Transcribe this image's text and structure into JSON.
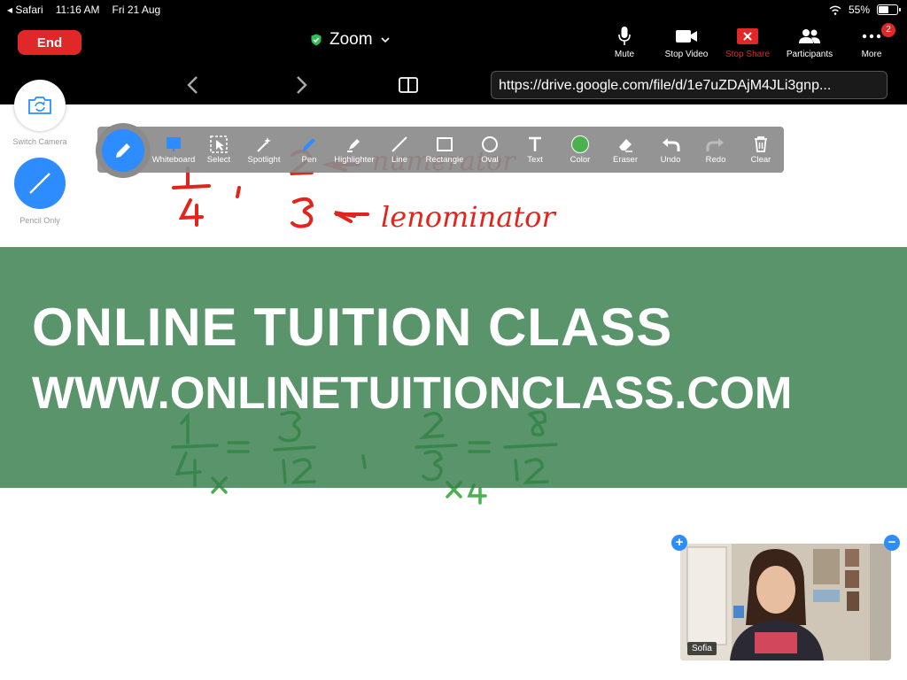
{
  "status_bar": {
    "back_app": "◂ Safari",
    "time": "11:16 AM",
    "date": "Fri 21 Aug",
    "battery": "55%",
    "battery_level": 0.55
  },
  "zoom": {
    "end_label": "End",
    "title": "Zoom",
    "toolbar": {
      "mute": "Mute",
      "stop_video": "Stop Video",
      "stop_share": "Stop Share",
      "participants": "Participants",
      "more": "More",
      "more_badge": "2"
    }
  },
  "browser": {
    "url": "https://drive.google.com/file/d/1e7uZDAjM4JLi3gnp..."
  },
  "side_controls": {
    "switch_camera": "Switch Camera",
    "pencil_only": "Pencil Only"
  },
  "annotation_tools": [
    {
      "label": "Whiteboard",
      "icon": "whiteboard-icon"
    },
    {
      "label": "Select",
      "icon": "select-icon"
    },
    {
      "label": "Spotlight",
      "icon": "spotlight-icon"
    },
    {
      "label": "Pen",
      "icon": "pen-icon"
    },
    {
      "label": "Highlighter",
      "icon": "highlighter-icon"
    },
    {
      "label": "Line",
      "icon": "line-icon"
    },
    {
      "label": "Rectangle",
      "icon": "rectangle-icon"
    },
    {
      "label": "Oval",
      "icon": "oval-icon"
    },
    {
      "label": "Text",
      "icon": "text-icon"
    },
    {
      "label": "Color",
      "icon": "color-icon"
    },
    {
      "label": "Eraser",
      "icon": "eraser-icon"
    },
    {
      "label": "Undo",
      "icon": "undo-icon"
    },
    {
      "label": "Redo",
      "icon": "redo-icon"
    },
    {
      "label": "Clear",
      "icon": "clear-icon"
    }
  ],
  "ink": {
    "red_color": "#e3241c",
    "green_color": "#4caf50",
    "numerator": "numerator",
    "denominator": "lenominator"
  },
  "banner": {
    "line1": "ONLINE TUITION CLASS",
    "line2": "WWW.ONLINETUITIONCLASS.COM"
  },
  "video": {
    "participant_name": "Sofia"
  },
  "colors": {
    "accent_blue": "#2d8cff",
    "end_red": "#e02828",
    "banner_green": "#347d4b"
  }
}
